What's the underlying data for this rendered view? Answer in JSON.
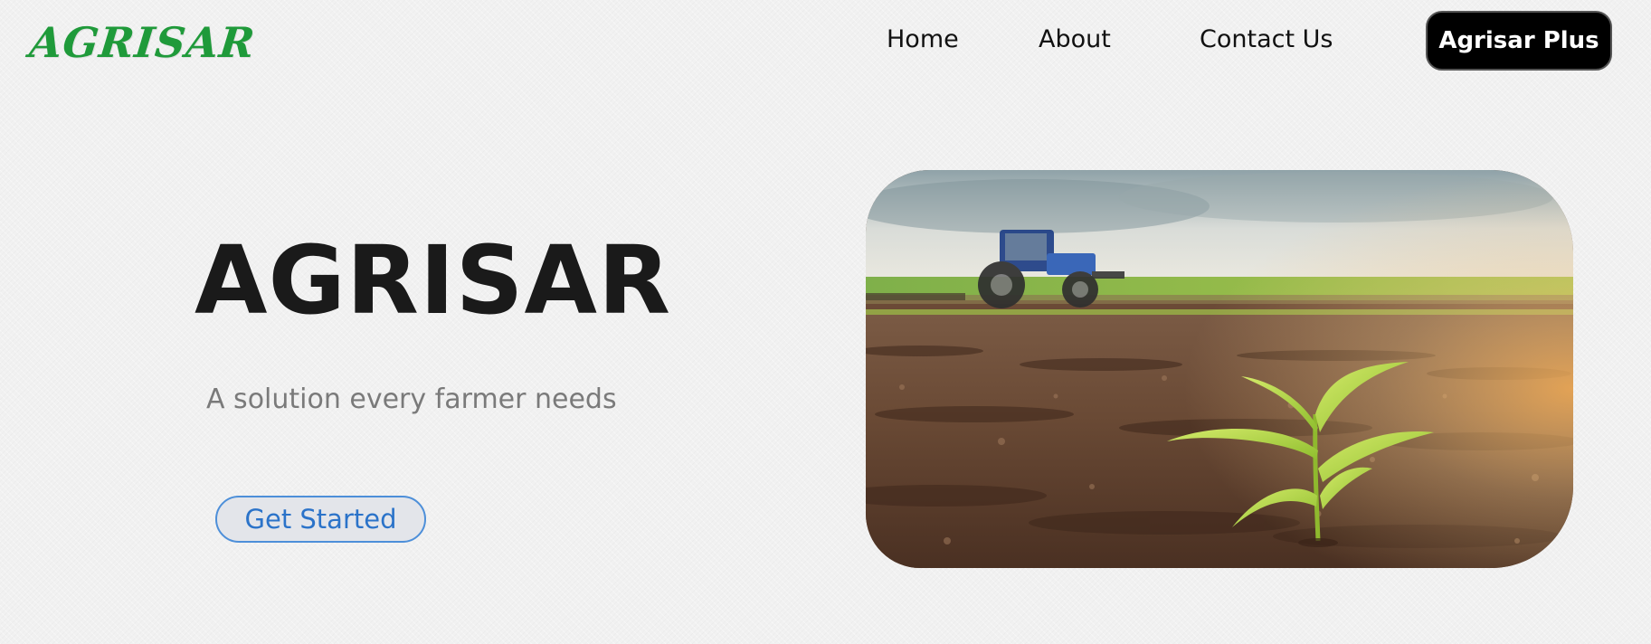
{
  "header": {
    "logo_text": "AGRISAR",
    "nav": {
      "home": "Home",
      "about": "About",
      "contact": "Contact Us"
    },
    "plus_button": "Agrisar Plus"
  },
  "hero": {
    "title": "AGRISAR",
    "subtitle": "A solution every farmer needs",
    "cta": "Get Started"
  },
  "colors": {
    "logo": "#1f9a3a",
    "cta_text": "#2b73c9",
    "cta_border": "#4d8fd9",
    "plus_bg": "#000000"
  },
  "image": {
    "subject": "tractor-in-field-with-corn-seedling"
  }
}
